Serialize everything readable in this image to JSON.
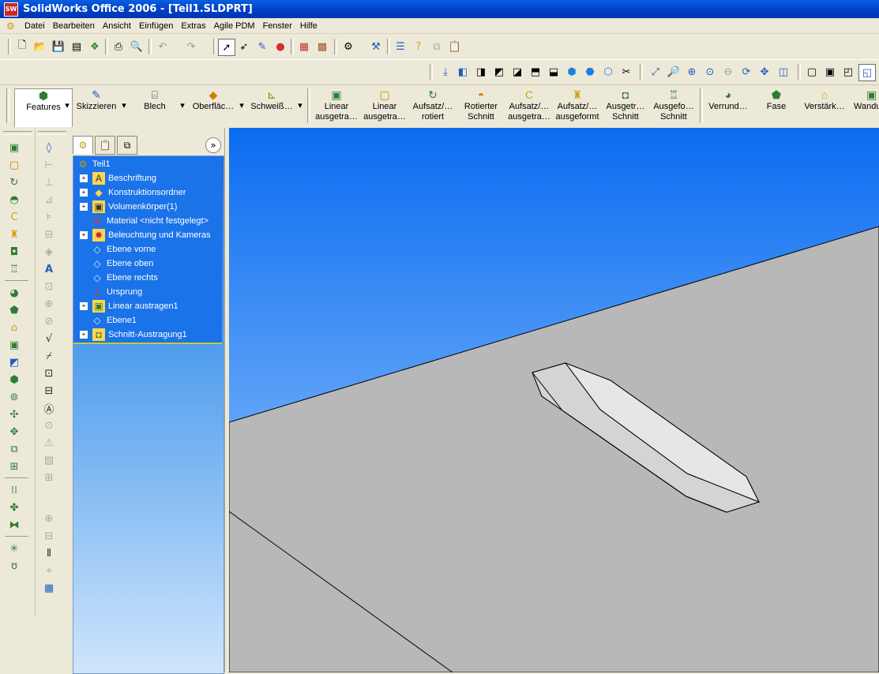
{
  "window": {
    "title": "SolidWorks Office 2006 - [Teil1.SLDPRT]",
    "app_icon_text": "SW"
  },
  "menubar": {
    "items": [
      "Datei",
      "Bearbeiten",
      "Ansicht",
      "Einfügen",
      "Extras",
      "Agile PDM",
      "Fenster",
      "Hilfe"
    ]
  },
  "command_manager": {
    "buttons": [
      {
        "label": "Features",
        "icon": "features-icon",
        "dropdown": true,
        "active": true
      },
      {
        "label": "Skizzieren",
        "icon": "sketch-icon",
        "dropdown": true
      },
      {
        "label": "Blech",
        "icon": "sheet-metal-icon",
        "dropdown": true
      },
      {
        "label": "Oberfläc…",
        "icon": "surface-icon",
        "dropdown": true
      },
      {
        "label": "Schweiß…",
        "icon": "weldment-icon",
        "dropdown": true
      },
      {
        "label": "Linear ausgetra…",
        "icon": "extrude-boss-icon"
      },
      {
        "label": "Linear ausgetra…",
        "icon": "extrude-cut-icon"
      },
      {
        "label": "Aufsatz/… rotiert",
        "icon": "revolve-icon"
      },
      {
        "label": "Rotierter Schnitt",
        "icon": "revolve-cut-icon"
      },
      {
        "label": "Aufsatz/… ausgetra…",
        "icon": "sweep-icon"
      },
      {
        "label": "Aufsatz/… ausgeformt",
        "icon": "loft-icon"
      },
      {
        "label": "Ausgetr… Schnitt",
        "icon": "sweep-cut-icon"
      },
      {
        "label": "Ausgefo… Schnitt",
        "icon": "loft-cut-icon"
      },
      {
        "label": "Verrund…",
        "icon": "fillet-icon"
      },
      {
        "label": "Fase",
        "icon": "chamfer-icon"
      },
      {
        "label": "Verstärk…",
        "icon": "rib-icon"
      },
      {
        "label": "Wandu…",
        "icon": "shell-icon"
      }
    ]
  },
  "feature_tree": {
    "tabs": [
      "featuremanager-tab",
      "propertymanager-tab",
      "configurationmanager-tab"
    ],
    "items": [
      {
        "label": "Teil1",
        "expandable": false,
        "icon": "part-icon"
      },
      {
        "label": "Beschriftung",
        "expandable": true,
        "icon": "annotations-icon"
      },
      {
        "label": "Konstruktionsordner",
        "expandable": true,
        "icon": "design-binder-icon"
      },
      {
        "label": "Volumenkörper(1)",
        "expandable": true,
        "icon": "solid-bodies-icon"
      },
      {
        "label": "Material <nicht festgelegt>",
        "expandable": false,
        "icon": "material-icon"
      },
      {
        "label": "Beleuchtung und Kameras",
        "expandable": true,
        "icon": "lights-icon"
      },
      {
        "label": "Ebene vorne",
        "expandable": false,
        "icon": "plane-icon"
      },
      {
        "label": "Ebene oben",
        "expandable": false,
        "icon": "plane-icon"
      },
      {
        "label": "Ebene rechts",
        "expandable": false,
        "icon": "plane-icon"
      },
      {
        "label": "Ursprung",
        "expandable": false,
        "icon": "origin-icon"
      },
      {
        "label": "Linear austragen1",
        "expandable": true,
        "icon": "extrude-feature-icon"
      },
      {
        "label": "Ebene1",
        "expandable": false,
        "icon": "plane-icon"
      },
      {
        "label": "Schnitt-Austragung1",
        "expandable": true,
        "icon": "sweep-cut-feature-icon"
      }
    ]
  },
  "colors": {
    "sky_top": "#0a6cf0",
    "sky_bottom": "#a9d2ff",
    "plate": "#b8b8b8",
    "part_light": "#e6e6e6",
    "part_mid": "#cfcfcf",
    "titlebar": "#0a50d8",
    "tree_blue": "#1a73e8"
  }
}
